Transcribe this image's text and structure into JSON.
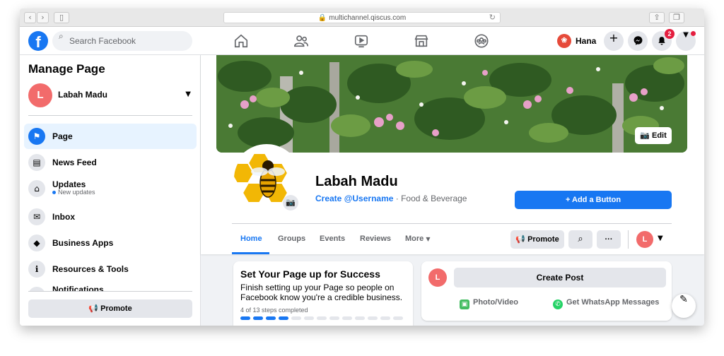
{
  "browser": {
    "url": "multichannel.qiscus.com"
  },
  "nav": {
    "search_placeholder": "Search Facebook",
    "profile_name": "Hana",
    "notification_count": "2"
  },
  "sidebar": {
    "title": "Manage Page",
    "page_initial": "L",
    "page_name": "Labah Madu",
    "items": [
      {
        "label": "Page",
        "icon": "flag-icon"
      },
      {
        "label": "News Feed",
        "icon": "news-feed-icon"
      },
      {
        "label": "Updates",
        "sub": "New updates",
        "icon": "updates-icon"
      },
      {
        "label": "Inbox",
        "icon": "inbox-icon"
      },
      {
        "label": "Business Apps",
        "icon": "cube-icon"
      },
      {
        "label": "Resources & Tools",
        "icon": "info-icon"
      },
      {
        "label": "Notifications",
        "icon": "bell-icon"
      }
    ],
    "promote_label": "Promote"
  },
  "page": {
    "name": "Labah Madu",
    "username_link": "Create @Username",
    "category": " · Food & Beverage",
    "edit_cover": "Edit",
    "add_button": "Add a Button",
    "tabs": [
      "Home",
      "Groups",
      "Events",
      "Reviews",
      "More"
    ],
    "promote_label": "Promote",
    "more_dots": "···",
    "initial": "L"
  },
  "setup_card": {
    "title": "Set Your Page up for Success",
    "description": "Finish setting up your Page so people on Facebook know you're a credible business.",
    "progress_text": "4 of 13 steps completed",
    "steps_total": 13,
    "steps_done": 4
  },
  "post_card": {
    "initial": "L",
    "create_post": "Create Post",
    "photo_video": "Photo/Video",
    "whatsapp": "Get WhatsApp Messages"
  },
  "colors": {
    "brand": "#1877f2",
    "avatar": "#f26b6b",
    "badge": "#e41e3f"
  }
}
